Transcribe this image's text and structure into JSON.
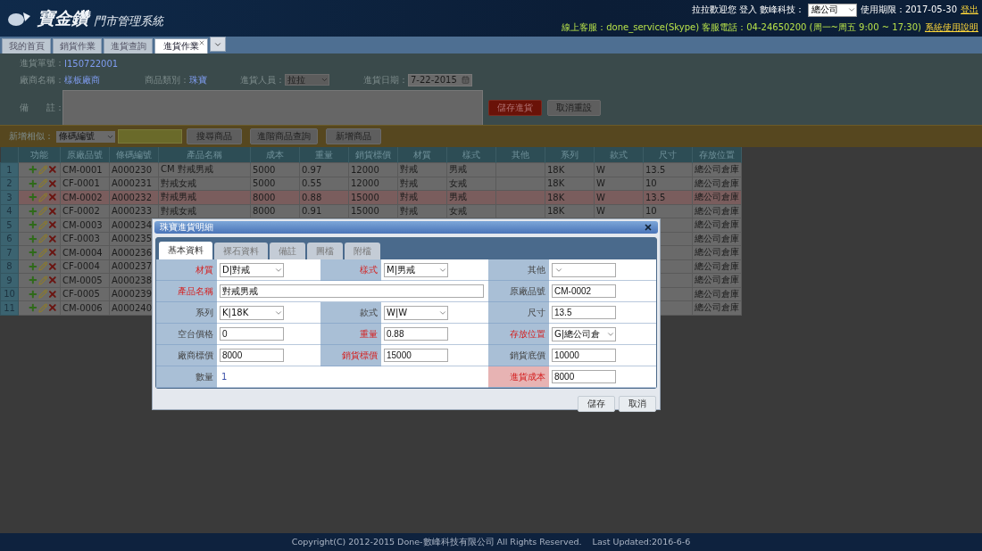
{
  "header": {
    "logo_title": "寶金鑽",
    "logo_subtitle": "門市管理系統",
    "greeting": "拉拉歡迎您 登入 數峰科技：",
    "branch_select": "總公司",
    "expiry": "使用期限：2017-05-30",
    "logout": "登出",
    "support": "線上客服：done_service(Skype)   客服電話：04-24650200 (周一~周五 9:00 ~ 17:30)",
    "help_link": "系統使用說明"
  },
  "tabs": [
    {
      "label": "我的首頁",
      "selected": false,
      "closable": false
    },
    {
      "label": "銷貨作業",
      "selected": false,
      "closable": false
    },
    {
      "label": "進貨查詢",
      "selected": false,
      "closable": false
    },
    {
      "label": "進貨作業",
      "selected": true,
      "closable": true
    }
  ],
  "form": {
    "order_label": "進貨單號：",
    "order_no": "I150722001",
    "vendor_label": "廠商名稱：",
    "vendor": "樣板廠商",
    "category_label": "商品類別：",
    "category": "珠寶",
    "staff_label": "進貨人員：",
    "staff": "拉拉",
    "date_label": "進貨日期：",
    "date": "7-22-2015",
    "note_label": "備　　註：",
    "save": "儲存進貨",
    "reset": "取消重設"
  },
  "search_bar": {
    "label": "新增相似：",
    "select": "條碼編號",
    "buttons": [
      "搜尋商品",
      "進階商品查詢",
      "新增商品"
    ]
  },
  "table": {
    "columns": [
      "功能",
      "原廠品號",
      "條碼編號",
      "產品名稱",
      "成本",
      "重量",
      "銷貨標價",
      "材質",
      "樣式",
      "其他",
      "系列",
      "款式",
      "尺寸",
      "存放位置"
    ],
    "rows": [
      {
        "no": "1",
        "selected": false,
        "cells": [
          "",
          "CM-0001",
          "A000230",
          "CM 對戒男戒",
          "5000",
          "0.97",
          "12000",
          "對戒",
          "男戒",
          null,
          "18K",
          "W",
          "13.5",
          "總公司倉庫"
        ]
      },
      {
        "no": "2",
        "selected": false,
        "cells": [
          "",
          "CF-0001",
          "A000231",
          "對戒女戒",
          "5000",
          "0.55",
          "12000",
          "對戒",
          "女戒",
          null,
          "18K",
          "W",
          "10",
          "總公司倉庫"
        ]
      },
      {
        "no": "3",
        "selected": true,
        "cells": [
          "",
          "CM-0002",
          "A000232",
          "對戒男戒",
          "8000",
          "0.88",
          "15000",
          "對戒",
          "男戒",
          null,
          "18K",
          "W",
          "13.5",
          "總公司倉庫"
        ]
      },
      {
        "no": "4",
        "selected": false,
        "cells": [
          "",
          "CF-0002",
          "A000233",
          "對戒女戒",
          "8000",
          "0.91",
          "15000",
          "對戒",
          "女戒",
          null,
          "18K",
          "W",
          "10",
          "總公司倉庫"
        ]
      },
      {
        "no": "5",
        "selected": false,
        "cells": [
          "",
          "CM-0003",
          "A000234",
          null,
          null,
          null,
          null,
          null,
          null,
          null,
          null,
          null,
          null,
          "總公司倉庫"
        ]
      },
      {
        "no": "6",
        "selected": false,
        "cells": [
          "",
          "CF-0003",
          "A000235",
          null,
          null,
          null,
          null,
          null,
          null,
          null,
          null,
          null,
          null,
          "總公司倉庫"
        ]
      },
      {
        "no": "7",
        "selected": false,
        "cells": [
          "",
          "CM-0004",
          "A000236",
          null,
          null,
          null,
          null,
          null,
          null,
          null,
          null,
          null,
          null,
          "總公司倉庫"
        ]
      },
      {
        "no": "8",
        "selected": false,
        "cells": [
          "",
          "CF-0004",
          "A000237",
          null,
          null,
          null,
          null,
          null,
          null,
          null,
          null,
          null,
          null,
          "總公司倉庫"
        ]
      },
      {
        "no": "9",
        "selected": false,
        "cells": [
          "",
          "CM-0005",
          "A000238",
          null,
          null,
          null,
          null,
          null,
          null,
          null,
          null,
          null,
          null,
          "總公司倉庫"
        ]
      },
      {
        "no": "10",
        "selected": false,
        "cells": [
          "",
          "CF-0005",
          "A000239",
          null,
          null,
          null,
          null,
          null,
          null,
          null,
          null,
          null,
          null,
          "總公司倉庫"
        ]
      },
      {
        "no": "11",
        "selected": false,
        "cells": [
          "",
          "CM-0006",
          "A000240",
          null,
          null,
          null,
          null,
          null,
          null,
          null,
          null,
          null,
          null,
          "總公司倉庫"
        ]
      }
    ]
  },
  "dialog": {
    "title": "珠寶進貨明細",
    "tabs": [
      {
        "label": "基本資料",
        "selected": true
      },
      {
        "label": "裸石資料",
        "selected": false
      },
      {
        "label": "備註",
        "selected": false
      },
      {
        "label": "圖檔",
        "selected": false
      },
      {
        "label": "附檔",
        "selected": false
      }
    ],
    "rows": [
      [
        {
          "label": "材質",
          "required": true,
          "kind": "select",
          "value": "D|對戒"
        },
        {
          "label": "樣式",
          "required": true,
          "kind": "select",
          "value": "M|男戒"
        },
        {
          "label": "其他",
          "required": false,
          "kind": "select"
        }
      ],
      [
        {
          "label": "產品名稱",
          "required": true,
          "kind": "wide_input",
          "value": "對戒男戒"
        },
        {
          "label": "原廠品號",
          "required": false,
          "kind": "input",
          "value": "CM-0002"
        }
      ],
      [
        {
          "label": "系列",
          "required": false,
          "kind": "select",
          "value": "K|18K"
        },
        {
          "label": "款式",
          "required": false,
          "kind": "select",
          "value": "W|W"
        },
        {
          "label": "尺寸",
          "required": false,
          "kind": "input",
          "value": "13.5"
        }
      ],
      [
        {
          "label": "空台價格",
          "required": false,
          "kind": "input",
          "value": "0"
        },
        {
          "label": "重量",
          "required": true,
          "kind": "input",
          "value": "0.88"
        },
        {
          "label": "存放位置",
          "required": true,
          "kind": "select",
          "value": "G|總公司倉"
        }
      ],
      [
        {
          "label": "廠商標價",
          "required": false,
          "kind": "input",
          "value": "8000"
        },
        {
          "label": "銷貨標價",
          "required": true,
          "kind": "input",
          "value": "15000"
        },
        {
          "label": "銷貨底價",
          "required": false,
          "kind": "input",
          "value": "10000"
        }
      ],
      [
        {
          "label": "數量",
          "required": false,
          "kind": "text",
          "value": "1"
        },
        {
          "label": "進貨成本",
          "required": true,
          "highlighted": true,
          "kind": "input",
          "value": "8000"
        }
      ]
    ],
    "buttons": [
      "儲存",
      "取消"
    ]
  },
  "footer": "Copyright(C) 2012-2015 Done-數峰科技有限公司 All Rights Reserved.    Last Updated:2016-6-6"
}
